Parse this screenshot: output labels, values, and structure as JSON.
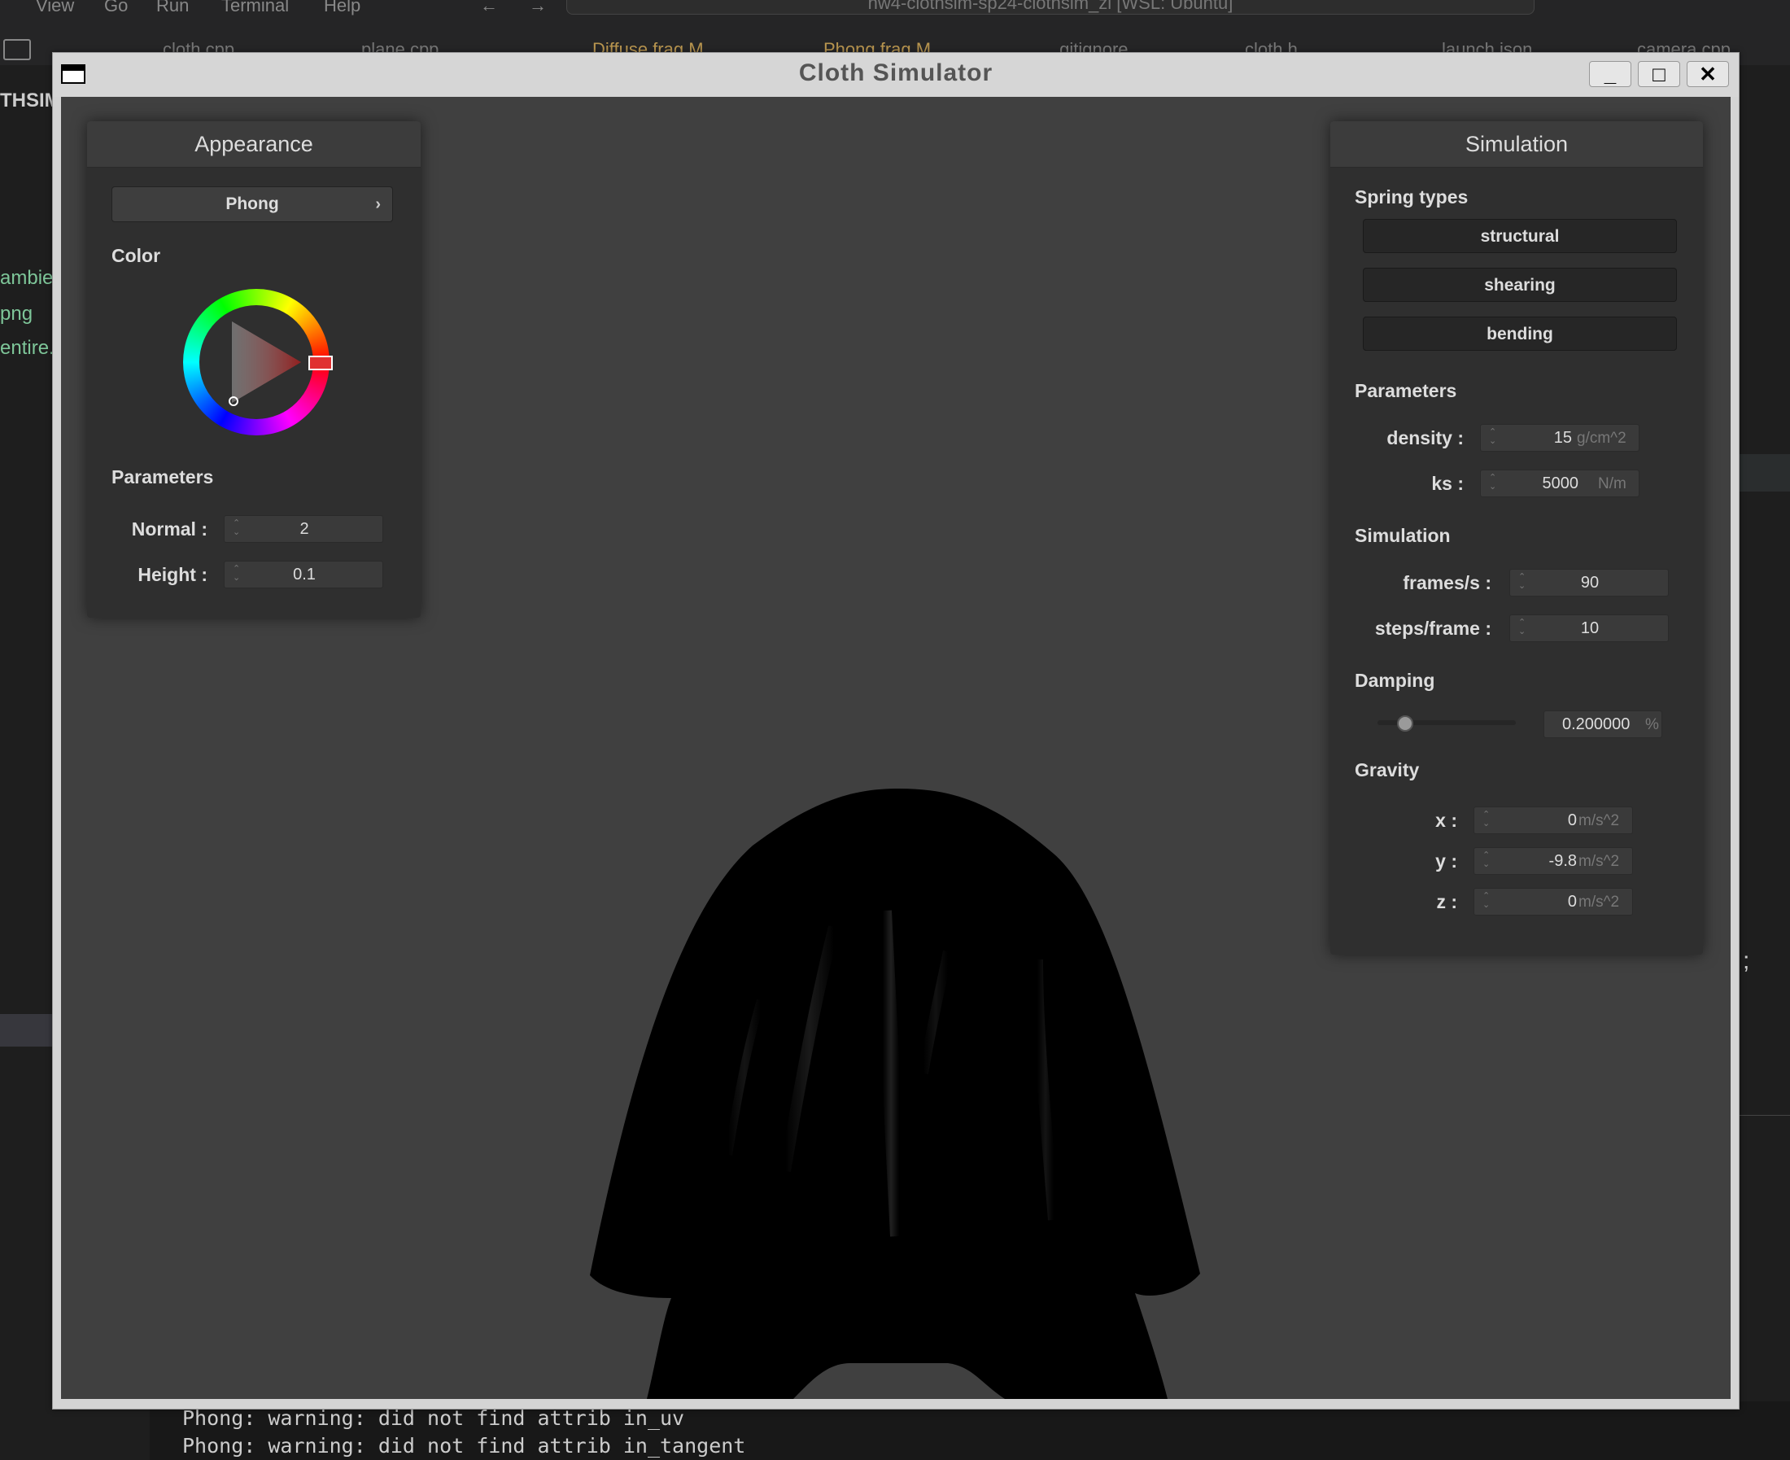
{
  "vscode": {
    "menu": [
      "View",
      "Go",
      "Run",
      "Terminal",
      "Help"
    ],
    "command_center": "hw4-clothsim-sp24-clothsim_zi [WSL: Ubuntu]",
    "tabs": [
      "cloth.cpp",
      "plane.cpp",
      "Diffuse.frag M",
      "Phong.frag M",
      ".gitignore",
      "cloth.h",
      "launch.json",
      "camera.cpp"
    ],
    "sidebar_title": "THSIM",
    "sidebar_lines": [
      "ambie",
      "png",
      "entire."
    ],
    "terminal_lines": [
      "Phong: warning: did not find attrib in_uv",
      "Phong: warning: did not find attrib in_tangent"
    ]
  },
  "window": {
    "title": "Cloth Simulator",
    "minimize_glyph": "_",
    "maximize_glyph": "□",
    "close_glyph": "✕"
  },
  "appearance": {
    "header": "Appearance",
    "shader": "Phong",
    "color_label": "Color",
    "color_value": "#e03030",
    "parameters_label": "Parameters",
    "normal_label": "Normal :",
    "normal_value": "2",
    "height_label": "Height :",
    "height_value": "0.1"
  },
  "simulation": {
    "header": "Simulation",
    "spring_types_label": "Spring types",
    "springs": [
      "structural",
      "shearing",
      "bending"
    ],
    "parameters_label": "Parameters",
    "density_label": "density :",
    "density_value": "15",
    "density_unit": "g/cm^2",
    "ks_label": "ks :",
    "ks_value": "5000",
    "ks_unit": "N/m",
    "simulation_label": "Simulation",
    "fps_label": "frames/s :",
    "fps_value": "90",
    "steps_label": "steps/frame :",
    "steps_value": "10",
    "damping_label": "Damping",
    "damping_value": "0.200000",
    "damping_unit": "%",
    "damping_fraction": 0.2,
    "gravity_label": "Gravity",
    "gx_label": "x :",
    "gx_value": "0",
    "gy_label": "y :",
    "gy_value": "-9.8",
    "gz_label": "z :",
    "gz_value": "0",
    "gravity_unit": "m/s^2"
  }
}
